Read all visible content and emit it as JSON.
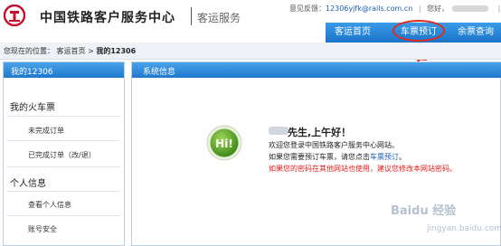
{
  "header": {
    "site_title": "中国铁路客户服务中心",
    "sub_title": "客运服务"
  },
  "topbar": {
    "feedback_label": "意见反馈：",
    "feedback_email": "12306yjfk@rails.com.cn",
    "greeting_label": "您好，",
    "logout": "退出"
  },
  "nav": {
    "items": [
      "客运首页",
      "车票预订",
      "余票查询"
    ]
  },
  "breadcrumb": {
    "prefix": "您现在的位置：",
    "home": "客运首页",
    "sep": ">",
    "current": "我的12306"
  },
  "sidebar": {
    "title": "我的12306",
    "groups": [
      {
        "label": "我的火车票",
        "items": [
          "未完成订单",
          "已完成订单（改/退）"
        ]
      },
      {
        "label": "个人信息",
        "items": [
          "查看个人信息",
          "账号安全"
        ]
      }
    ]
  },
  "main": {
    "title": "系统信息",
    "icon_text": "Hi!",
    "greeting": "先生,上午好！",
    "welcome": "欢迎您登录中国铁路客户服务中心网站。",
    "booking_prefix": "如果您需要预订车票，请您点击",
    "booking_link": "车票预订",
    "booking_suffix": "。",
    "warning": "如果您的密码在其他网站也使用，建议您修改本网站密码。"
  },
  "watermark": {
    "text": "Baidu 经验",
    "sub": "jingyan.baidu.com"
  },
  "colors": {
    "brand_blue": "#1f78cc",
    "annotation_red": "#e02a1d",
    "warning_red": "#e01e1e",
    "hi_green": "#5aa422"
  }
}
